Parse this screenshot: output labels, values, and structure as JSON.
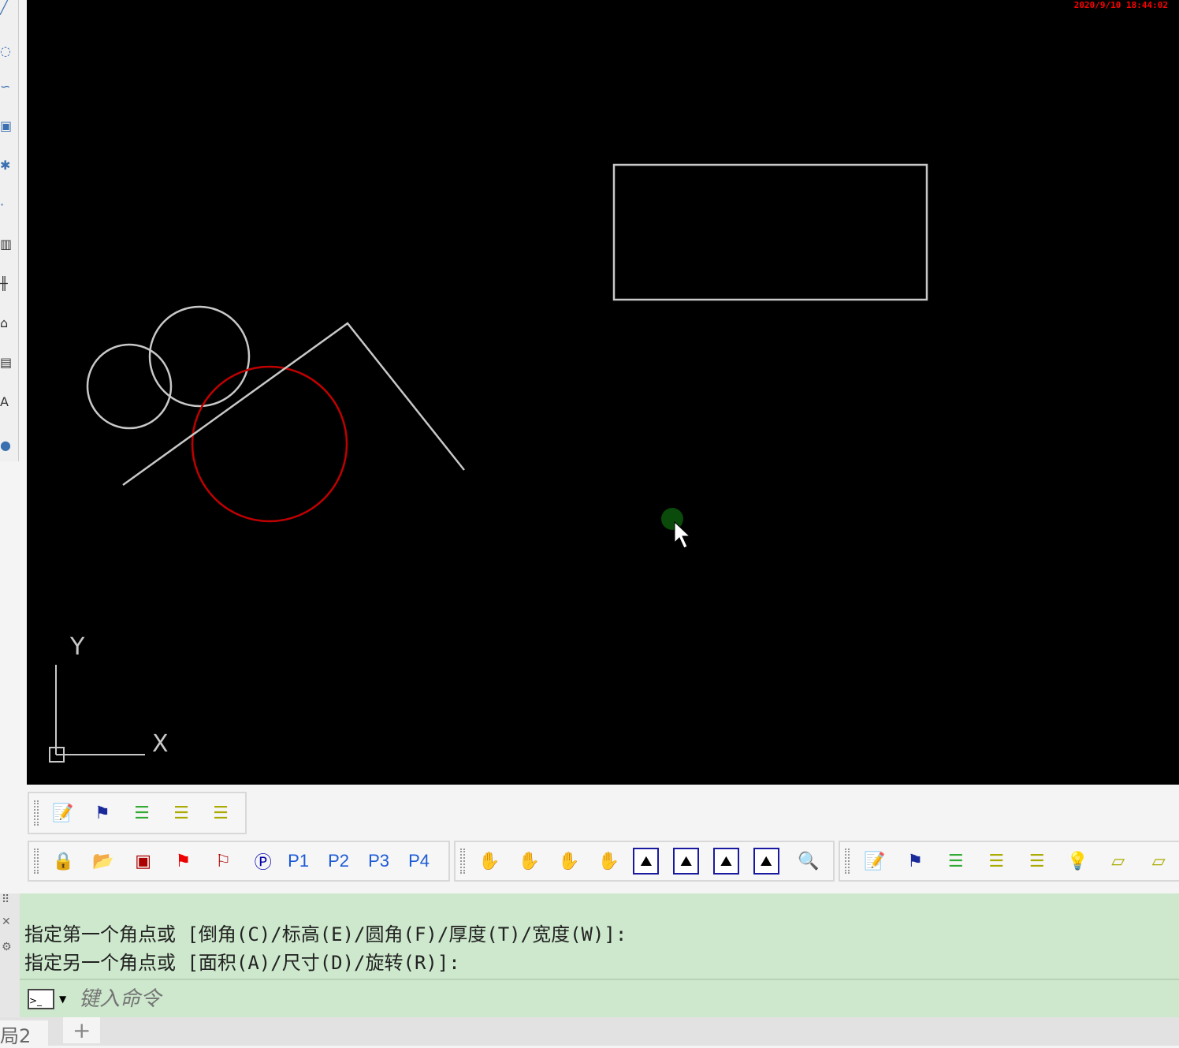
{
  "timestamp": "2020/9/10 18:44:02",
  "ucs": {
    "x": "X",
    "y": "Y"
  },
  "toolbar2": {
    "p1": "P1",
    "p2": "P2",
    "p3": "P3",
    "p4": "P4"
  },
  "command": {
    "line1": "指定第一个角点或 [倒角(C)/标高(E)/圆角(F)/厚度(T)/宽度(W)]:",
    "line2": "指定另一个角点或 [面积(A)/尺寸(D)/旋转(R)]:",
    "placeholder": "键入命令"
  },
  "tabs": {
    "layout": "局2",
    "add": "+"
  },
  "colors": {
    "canvas": "#000000",
    "red_circle": "#c00000",
    "command_bg": "#cde8cc"
  }
}
